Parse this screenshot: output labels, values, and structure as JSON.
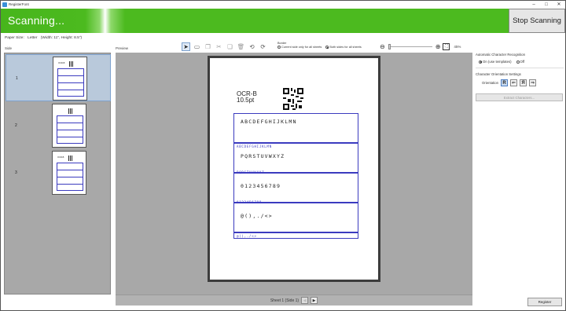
{
  "window": {
    "title": "RegisterFont",
    "controls": {
      "minimize": "–",
      "maximize": "□",
      "close": "✕"
    }
  },
  "banner": {
    "status": "Scanning...",
    "stop_label": "Stop Scanning",
    "color": "#4cba1f"
  },
  "paper": {
    "label": "Paper Size:",
    "value": "Letter",
    "dims": "(Width: 11\", Height: 8.5\")"
  },
  "sections": {
    "side_label": "Side",
    "preview_label": "Preview"
  },
  "thumbnails": [
    {
      "num": "1",
      "ocr": "OCR-B"
    },
    {
      "num": "2",
      "ocr": ""
    },
    {
      "num": "3",
      "ocr": "OCR-B"
    }
  ],
  "toolbar": {
    "icons": [
      "pointer-icon",
      "rectangle-icon",
      "copy-icon",
      "cut-icon",
      "paste-icon",
      "delete-icon",
      "rotate-left-icon",
      "rotate-right-icon"
    ],
    "border_title": "Border",
    "border_current": "Current side only for all sheets",
    "border_both": "Both sides for all sheets",
    "zoom_pct": "45%"
  },
  "page": {
    "ocr_title": "OCR-B",
    "ocr_size": "10.5pt",
    "boxes": [
      {
        "text": "ABCDEFGHIJKLMN",
        "sub": "ABCDEFGHIJKLMN"
      },
      {
        "text": "PQRSTUVWXYZ",
        "sub": "PQRSTUVWXYZ"
      },
      {
        "text": "0123456789",
        "sub": "0123456789"
      },
      {
        "text": "@(),./<>",
        "sub": "@(),./<>"
      }
    ]
  },
  "sheet_nav": {
    "label": "Sheet 1 (Side 1)",
    "prev": "◀",
    "next": "▶"
  },
  "right_panel": {
    "acr_title": "Automatic Character Recognition",
    "opt_templates": "On (use templates)",
    "opt_off": "Off",
    "orient_title": "Character Orientation Settings",
    "orient_label": "Orientation",
    "orient_options": [
      "R",
      "⇐",
      "Я",
      "⇒"
    ],
    "extract_label": "Extract Characters..."
  },
  "register_label": "Register"
}
